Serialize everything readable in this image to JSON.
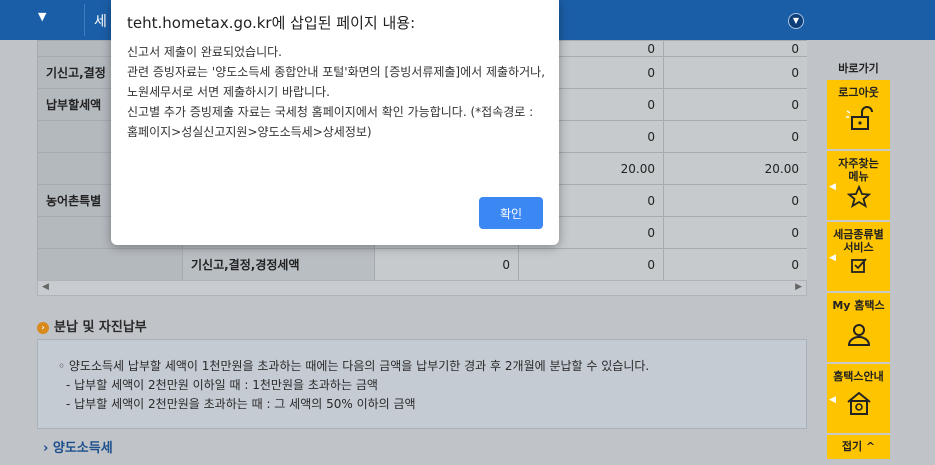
{
  "header": {
    "menu_text": "세",
    "dropdown_icon": "caret-down-icon",
    "toggle_icon": "chevron-down-circle-icon"
  },
  "table": {
    "rows": [
      {
        "label": "",
        "sub": "",
        "v1": "",
        "v2": "0",
        "v3": "0",
        "v4": "0"
      },
      {
        "label": "기신고,결정",
        "sub": "",
        "v1": "",
        "v2": "0",
        "v3": "0",
        "v4": "0"
      },
      {
        "label": "납부할세액",
        "sub": "",
        "v1": "",
        "v2": "0",
        "v3": "0",
        "v4": "0"
      },
      {
        "label": "",
        "sub": "",
        "v1": "",
        "v2": "0",
        "v3": "0",
        "v4": "0"
      },
      {
        "label": "",
        "sub": "",
        "v1": "",
        "v2": "20.00",
        "v3": "20.00",
        "v4": "20.00"
      },
      {
        "label": "농어촌특별",
        "sub": "",
        "v1": "",
        "v2": "0",
        "v3": "0",
        "v4": "0"
      },
      {
        "label": "",
        "sub": "",
        "v1": "",
        "v2": "0",
        "v3": "0",
        "v4": "0"
      },
      {
        "label": "",
        "sub": "기신고,결정,경정세액",
        "v1": "0",
        "v2": "0",
        "v3": "0",
        "v4": "0"
      }
    ]
  },
  "installment": {
    "title": "분납 및 자진납부",
    "line1": "◦ 양도소득세 납부할 세액이 1천만원을 초과하는 때에는 다음의 금액을 납부기한 경과 후 2개월에 분납할 수 있습니다.",
    "line2": "- 납부할 세액이 2천만원 이하일 때 : 1천만원을 초과하는 금액",
    "line3": "- 납부할 세액이 2천만원을 초과하는 때 : 그 세액의 50% 이하의 금액"
  },
  "link": {
    "label": "› 양도소득세"
  },
  "quick_menu": {
    "title": "바로가기",
    "items": [
      {
        "label": "로그아웃",
        "icon": "unlock-icon"
      },
      {
        "label": "자주찾는메뉴",
        "icon": "star-icon"
      },
      {
        "label": "세금종류별서비스",
        "icon": "checkbox-icon"
      },
      {
        "label": "My 홈택스",
        "icon": "user-icon"
      },
      {
        "label": "홈택스안내",
        "icon": "home-info-icon"
      }
    ],
    "fold": "접기 ^"
  },
  "dialog": {
    "title": "teht.hometax.go.kr에 삽입된 페이지 내용:",
    "line1": "신고서 제출이 완료되었습니다.",
    "line2": "관련 증빙자료는 '양도소득세 종합안내 포털'화면의 [증빙서류제출]에서 제출하거나, 노원세무서로 서면 제출하시기 바랍니다.",
    "line3": "신고별 추가 증빙제출 자료는 국세청 홈페이지에서 확인 가능합니다. (*접속경로 : 홈페이지>성실신고지원>양도소득세>상세정보)",
    "ok_label": "확인"
  }
}
